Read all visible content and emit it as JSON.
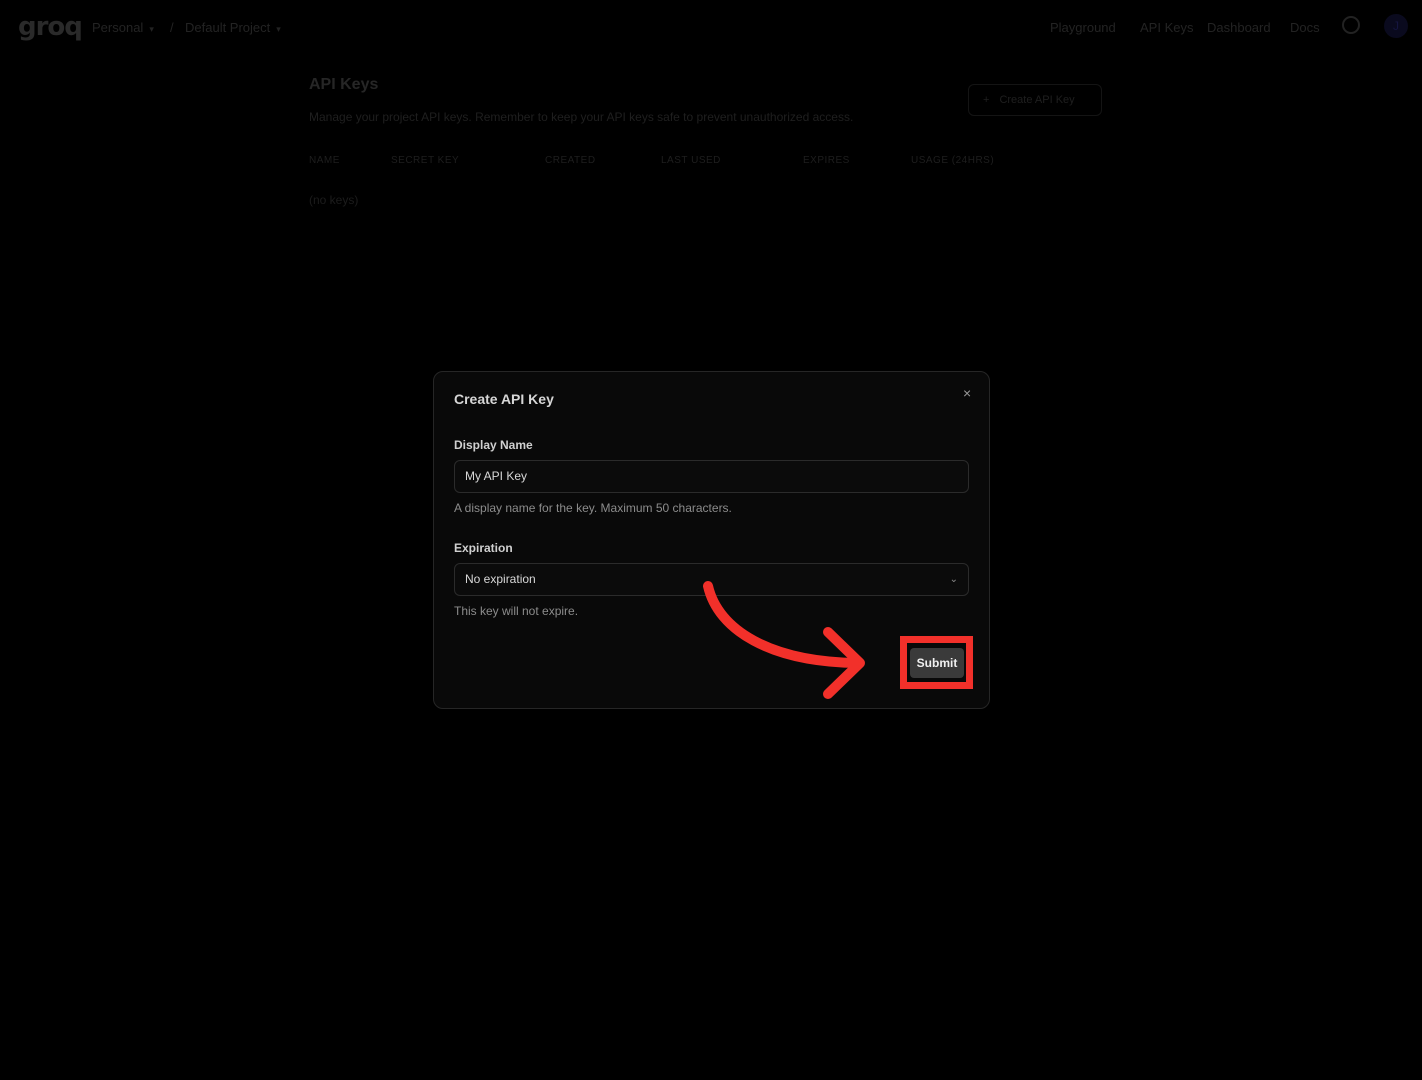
{
  "topbar": {
    "logo": "groq",
    "breadcrumb": [
      "Personal",
      "/",
      "Default Project"
    ],
    "nav": [
      "Playground",
      "API Keys",
      "Dashboard",
      "Docs"
    ],
    "avatar_initial": "J"
  },
  "page": {
    "title": "API Keys",
    "description": "Manage your project API keys. Remember to keep your API keys safe to prevent unauthorized access.",
    "create_button": "Create API Key",
    "table_headers": [
      "NAME",
      "SECRET KEY",
      "CREATED",
      "LAST USED",
      "EXPIRES",
      "USAGE (24HRS)"
    ],
    "empty_text": "(no keys)"
  },
  "modal": {
    "title": "Create API Key",
    "display_name_label": "Display Name",
    "display_name_value": "My API Key",
    "display_name_help": "A display name for the key. Maximum 50 characters.",
    "expiration_label": "Expiration",
    "expiration_value": "No expiration",
    "expiration_help": "This key will not expire.",
    "submit_label": "Submit",
    "close_glyph": "×"
  },
  "annotation": {
    "color": "#f2302a"
  }
}
